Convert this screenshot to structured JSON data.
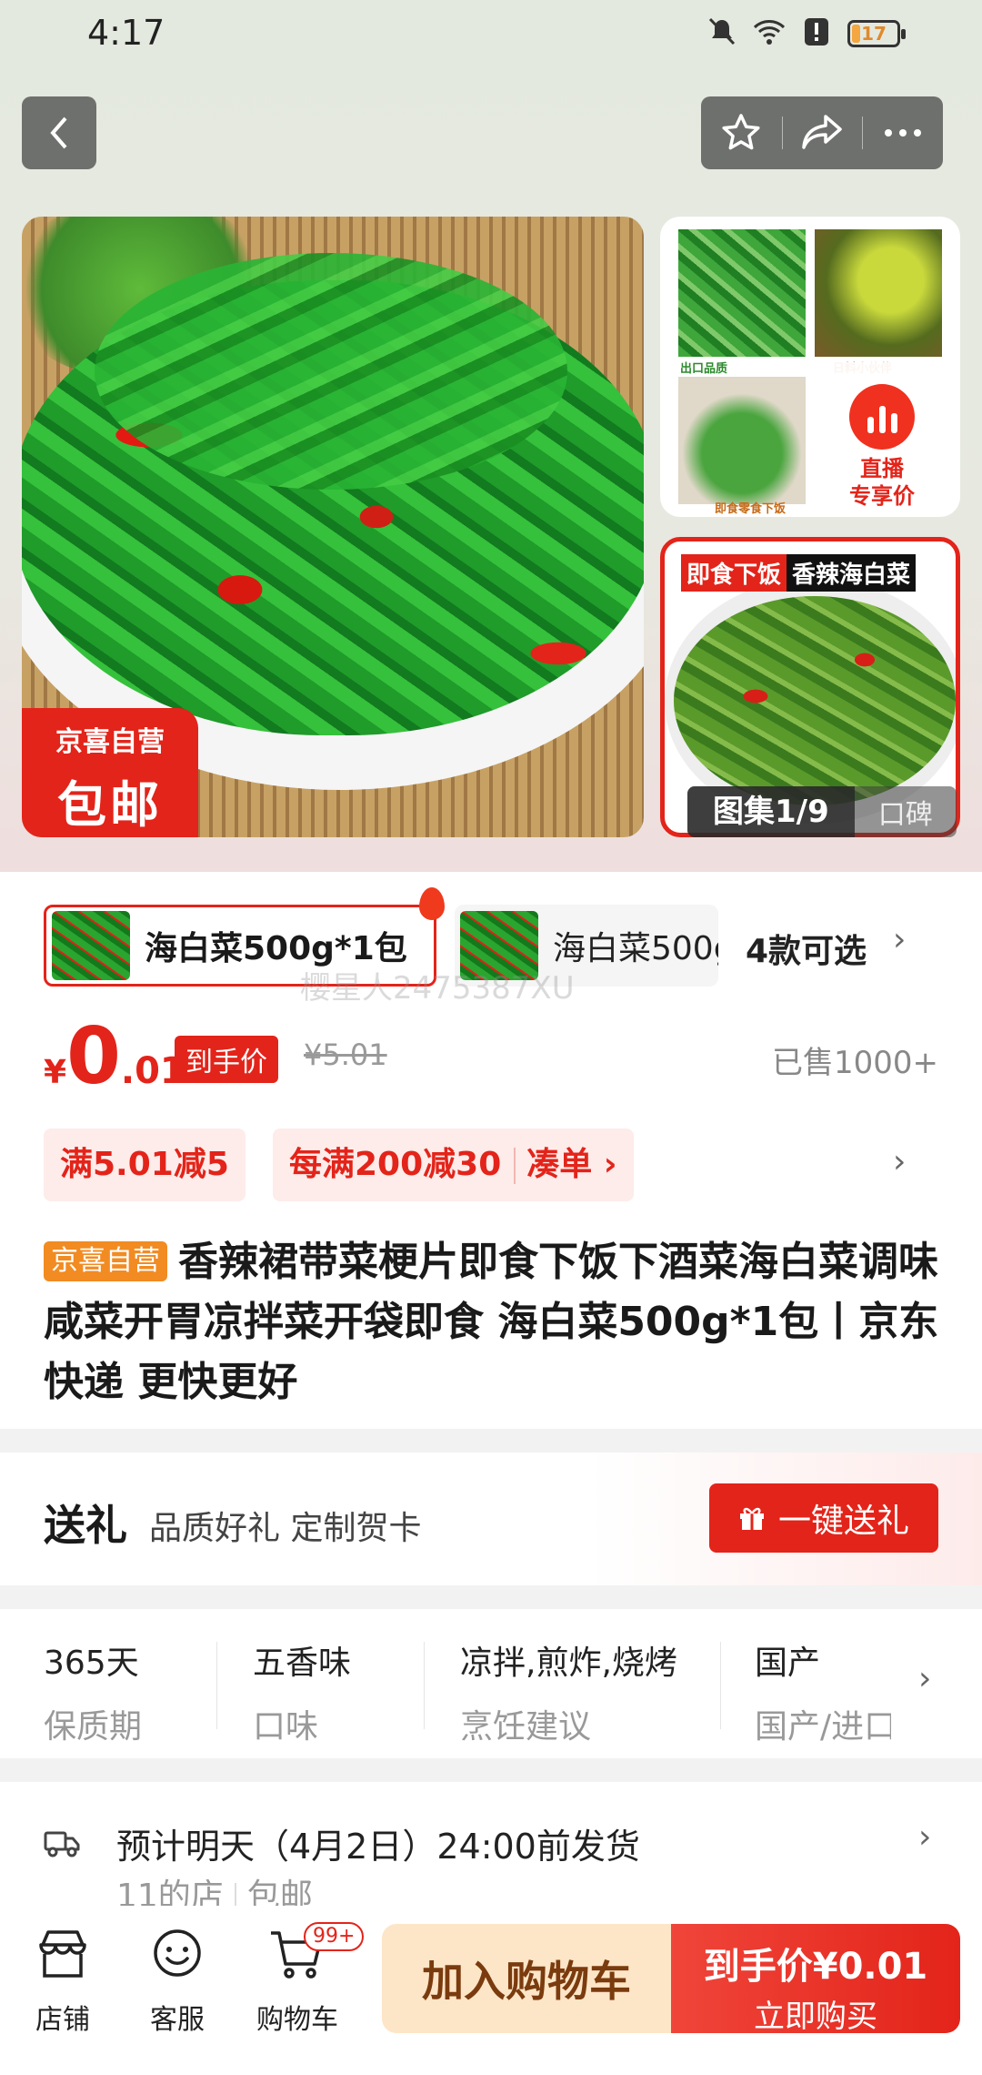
{
  "status_bar": {
    "time": "4:17",
    "battery": "17"
  },
  "header": {
    "back_icon": "chevron-left-icon",
    "actions": [
      "star-icon",
      "share-icon",
      "more-icon"
    ]
  },
  "hero": {
    "badge_top": "京喜自营",
    "badge_bottom": "包邮",
    "thumb_captions": [
      "出口品质",
      "日料小伙伴",
      "即食零食下饭"
    ],
    "live_label_1": "直播",
    "live_label_2": "专享价",
    "thumb2_banner_1": "即食下饭",
    "thumb2_banner_2": "香辣海白菜",
    "gallery": "图集1/9",
    "reviews": "口碑"
  },
  "variants": {
    "items": [
      "海白菜500g*1包",
      "海白菜500g"
    ],
    "count": "4款可选"
  },
  "watermark": "樱星人2475387XU",
  "price": {
    "currency": "¥",
    "integer": "0",
    "decimal": ".01",
    "tag": "到手价",
    "original": "¥5.01",
    "sold": "已售1000+"
  },
  "promos": {
    "p1": "满5.01减5",
    "p2": "每满200减30",
    "p2_action": "凑单"
  },
  "title": {
    "tag": "京喜自营",
    "text": "香辣裙带菜梗片即食下饭下酒菜海白菜调味咸菜开胃凉拌菜开袋即食 海白菜500g*1包丨京东快递 更快更好"
  },
  "gift": {
    "heading": "送礼",
    "sub": "品质好礼 定制贺卡",
    "button": "一键送礼"
  },
  "specs": [
    {
      "value": "365天",
      "key": "保质期"
    },
    {
      "value": "五香味",
      "key": "口味"
    },
    {
      "value": "凉拌,煎炸,烧烤",
      "key": "烹饪建议"
    },
    {
      "value": "国产",
      "key": "国产/进口"
    }
  ],
  "shipping": {
    "line1": "预计明天（4月2日）24:00前发货",
    "store": "11的店",
    "free": "包邮"
  },
  "bottom_nav": {
    "store": "店铺",
    "service": "客服",
    "cart": "购物车",
    "cart_badge": "99+",
    "add_cart": "加入购物车",
    "buy_price_label": "到手价",
    "buy_price": "¥0.01",
    "buy_now": "立即购买"
  },
  "colors": {
    "accent": "#e3241a",
    "tag_orange": "#f28b22",
    "add_cart_bg": "#fde5c7"
  }
}
